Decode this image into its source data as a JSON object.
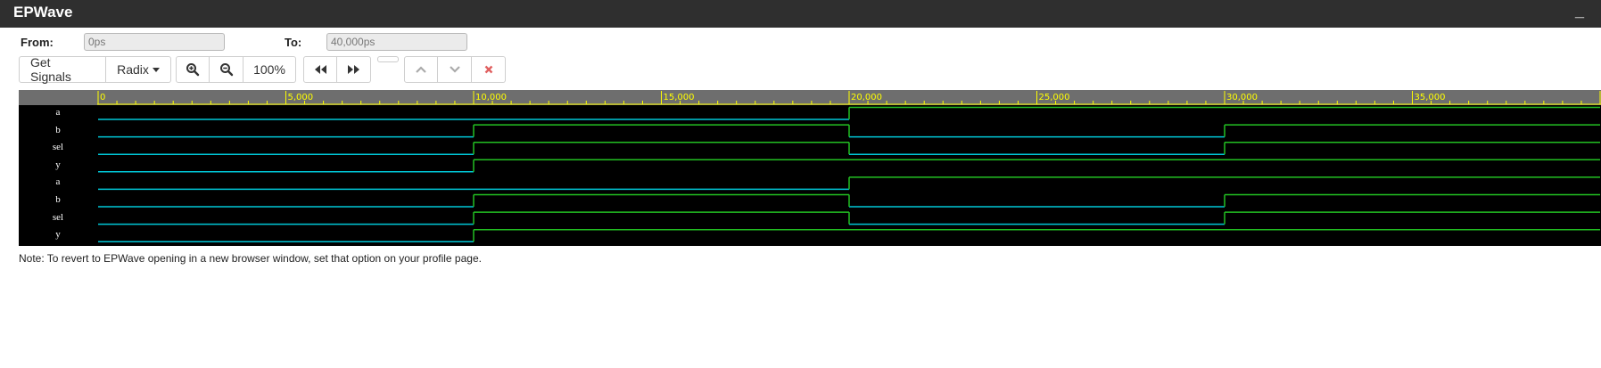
{
  "app": {
    "title": "EPWave",
    "minimize_glyph": "_"
  },
  "range": {
    "from_label": "From:",
    "from_value": "0ps",
    "to_label": "To:",
    "to_value": "40,000ps"
  },
  "toolbar": {
    "get_signals": "Get Signals",
    "radix": "Radix",
    "zoom_level": "100%",
    "icons": [
      "zoom-in-icon",
      "zoom-out-icon",
      "rewind-icon",
      "fast-forward-icon",
      "chevron-up-icon",
      "chevron-down-icon",
      "close-icon"
    ]
  },
  "timeline": {
    "start": 0,
    "end": 40000,
    "unit": "ps",
    "labels": [
      "0",
      "5,000",
      "10,000",
      "15,000",
      "20,000",
      "25,000",
      "30,000",
      "35,000"
    ],
    "label_values": [
      0,
      5000,
      10000,
      15000,
      20000,
      25000,
      30000,
      35000
    ],
    "minor_step": 500
  },
  "colors": {
    "low": "#00c8d8",
    "high": "#22c022",
    "ruler_text": "#ffff00",
    "ruler_bg": "#6e6e6e"
  },
  "signals": [
    {
      "name": "a",
      "transitions": [
        [
          0,
          0
        ],
        [
          20000,
          1
        ]
      ]
    },
    {
      "name": "b",
      "transitions": [
        [
          0,
          0
        ],
        [
          10000,
          1
        ],
        [
          20000,
          0
        ],
        [
          30000,
          1
        ]
      ]
    },
    {
      "name": "sel",
      "transitions": [
        [
          0,
          0
        ],
        [
          10000,
          1
        ],
        [
          20000,
          0
        ],
        [
          30000,
          1
        ]
      ]
    },
    {
      "name": "y",
      "transitions": [
        [
          0,
          0
        ],
        [
          10000,
          1
        ]
      ]
    },
    {
      "name": "a",
      "transitions": [
        [
          0,
          0
        ],
        [
          20000,
          1
        ]
      ]
    },
    {
      "name": "b",
      "transitions": [
        [
          0,
          0
        ],
        [
          10000,
          1
        ],
        [
          20000,
          0
        ],
        [
          30000,
          1
        ]
      ]
    },
    {
      "name": "sel",
      "transitions": [
        [
          0,
          0
        ],
        [
          10000,
          1
        ],
        [
          20000,
          0
        ],
        [
          30000,
          1
        ]
      ]
    },
    {
      "name": "y",
      "transitions": [
        [
          0,
          0
        ],
        [
          10000,
          1
        ]
      ]
    }
  ],
  "note": "Note: To revert to EPWave opening in a new browser window, set that option on your profile page."
}
